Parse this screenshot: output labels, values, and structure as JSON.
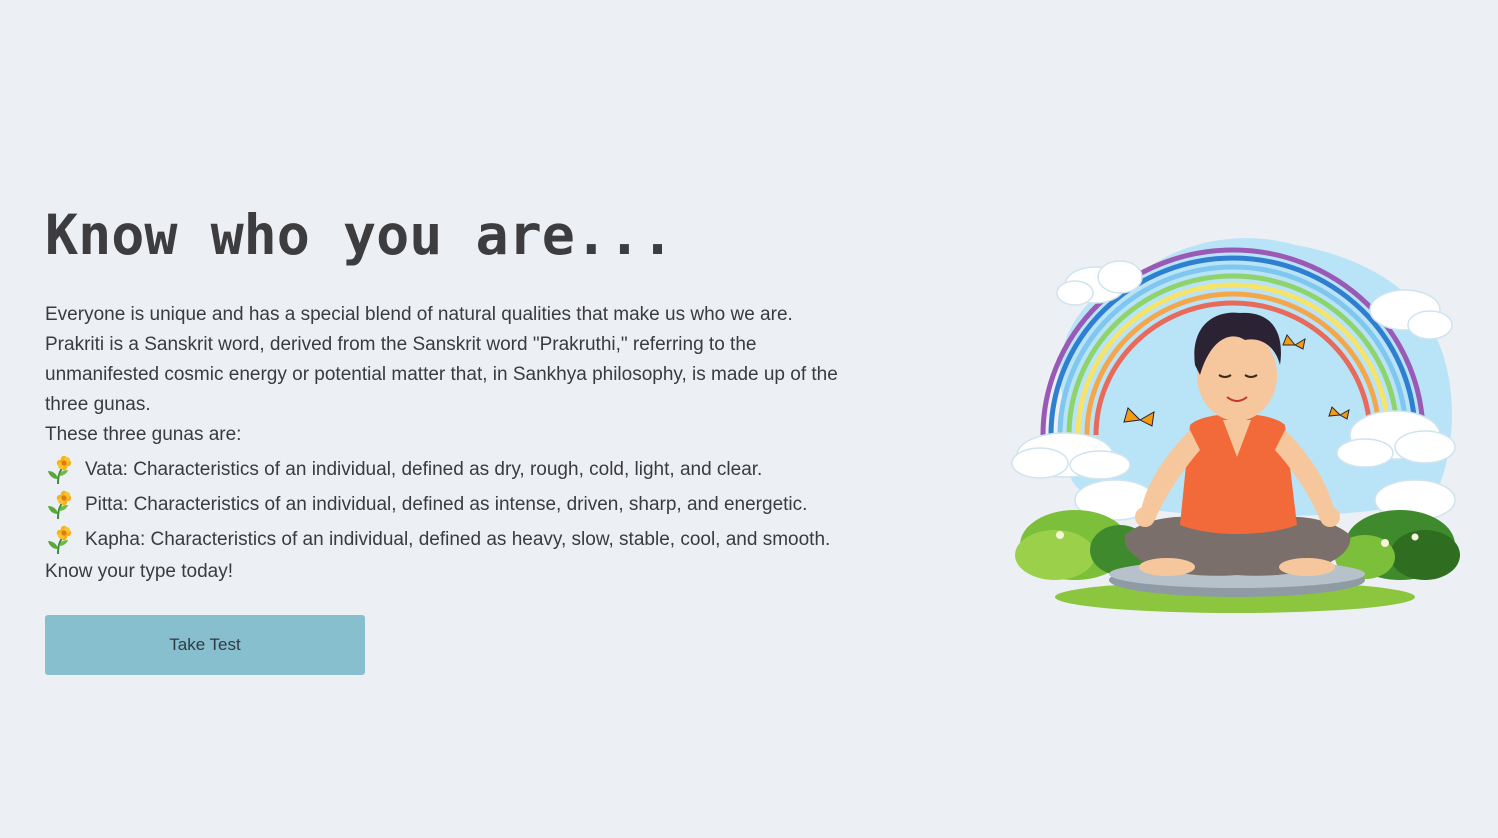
{
  "hero": {
    "title": "Know who you are...",
    "intro": "Everyone is unique and has a special blend of natural qualities that make us who we are. Prakriti is a Sanskrit word, derived from the Sanskrit word \"Prakruthi,\" referring to the unmanifested cosmic energy or potential matter that, in Sankhya philosophy, is made up of the three gunas.",
    "gunas_intro": "These three gunas are:",
    "gunas": [
      {
        "icon": "seedling-flower-icon",
        "text": "Vata: Characteristics of an individual, defined as dry, rough, cold, light, and clear."
      },
      {
        "icon": "seedling-flower-icon",
        "text": "Pitta: Characteristics of an individual, defined as intense, driven, sharp, and energetic."
      },
      {
        "icon": "seedling-flower-icon",
        "text": "Kapha: Characteristics of an individual, defined as heavy, slow, stable, cool, and smooth."
      }
    ],
    "closing": "Know your type today!",
    "cta_label": "Take Test"
  },
  "illustration": {
    "name": "meditating-boy-rainbow-illustration"
  },
  "colors": {
    "background": "#eceff4",
    "button": "#88bfcf",
    "text": "#3b3b3f"
  }
}
